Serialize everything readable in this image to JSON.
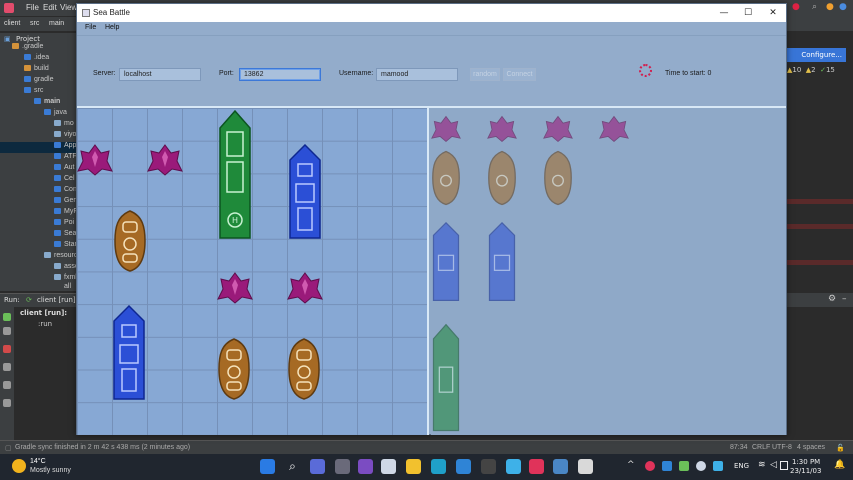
{
  "ide": {
    "menu": [
      "File",
      "Edit",
      "View"
    ],
    "breadcrumb": [
      "client",
      "src",
      "main"
    ],
    "project_label": "Project",
    "tree": [
      {
        "label": ".gradle",
        "icon": "orange"
      },
      {
        "label": ".idea",
        "icon": "blue"
      },
      {
        "label": "build",
        "icon": "orange"
      },
      {
        "label": "gradle",
        "icon": "blue"
      },
      {
        "label": "src",
        "icon": "blue"
      },
      {
        "label": "main",
        "icon": "blue"
      },
      {
        "label": "java",
        "icon": "blue"
      },
      {
        "label": "mo",
        "icon": "blue"
      },
      {
        "label": "viyo",
        "icon": "blue"
      },
      {
        "label": "App",
        "icon": "blue"
      },
      {
        "label": "ATF",
        "icon": "blue"
      },
      {
        "label": "Aut",
        "icon": "blue"
      },
      {
        "label": "Cel",
        "icon": "blue"
      },
      {
        "label": "Con",
        "icon": "blue"
      },
      {
        "label": "Gen",
        "icon": "blue"
      },
      {
        "label": "MyF",
        "icon": "blue"
      },
      {
        "label": "Poi",
        "icon": "blue"
      },
      {
        "label": "Sea",
        "icon": "blue"
      },
      {
        "label": "Star",
        "icon": "blue"
      },
      {
        "label": "resource",
        "icon": "blue"
      },
      {
        "label": "asse",
        "icon": "blue"
      },
      {
        "label": "fxml",
        "icon": "blue"
      },
      {
        "label": "all",
        "icon": "blue"
      }
    ],
    "run_label": "Run:",
    "run_tab": "client [run]",
    "run_tree": [
      "client [run]:",
      ":run"
    ],
    "configure": "Configure...",
    "stats": {
      "warn": "10",
      "a2": "2",
      "ok": "15"
    },
    "status_left": "Gradle sync finished in 2 m 42 s 438 ms (2 minutes ago)",
    "status_right": [
      "87:34",
      "CRLF",
      "UTF-8",
      "4 spaces"
    ]
  },
  "taskbar": {
    "weather_temp": "14°C",
    "weather_desc": "Mostly sunny",
    "lang": "ENG",
    "time": "1:30 PM",
    "date": "23/11/03"
  },
  "app": {
    "title": "Sea Battle",
    "menu": {
      "file": "File",
      "help": "Help"
    },
    "server_label": "Server:",
    "server_value": "localhost",
    "port_label": "Port:",
    "port_value": "13862",
    "username_label": "Username:",
    "username_value": "mamood",
    "random_label": "random",
    "connect_label": "Connect",
    "time_label": "Time to start: 0",
    "colors": {
      "green": "#1f8a3a",
      "blue": "#2b4fd6",
      "bronze": "#a66a24",
      "purple": "#9a1a7a"
    }
  }
}
